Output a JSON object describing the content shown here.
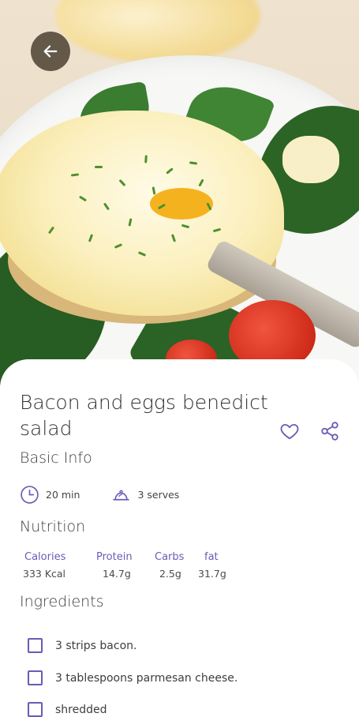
{
  "hero": {
    "image": "poached-egg-benedict-salad-photo",
    "back_icon": "arrow-left-icon"
  },
  "recipe": {
    "title": "Bacon and eggs benedict salad",
    "actions": {
      "favorite_icon": "heart-outline-icon",
      "share_icon": "share-icon"
    }
  },
  "basic_info": {
    "heading": "Basic Info",
    "time": "20 min",
    "serves": "3 serves"
  },
  "nutrition": {
    "heading": "Nutrition",
    "items": [
      {
        "label": "Calories",
        "value": "333 Kcal"
      },
      {
        "label": "Protein",
        "value": "14.7g"
      },
      {
        "label": "Carbs",
        "value": "2.5g"
      },
      {
        "label": "fat",
        "value": "31.7g"
      }
    ]
  },
  "ingredients": {
    "heading": "Ingredients",
    "items": [
      {
        "text": "3 strips bacon.",
        "checked": false
      },
      {
        "text": "3 tablespoons parmesan cheese.",
        "checked": false
      },
      {
        "text": "shredded",
        "checked": false
      }
    ]
  },
  "colors": {
    "accent": "#6a5cb6",
    "text": "#3d3d3d",
    "card": "#ffffff"
  }
}
